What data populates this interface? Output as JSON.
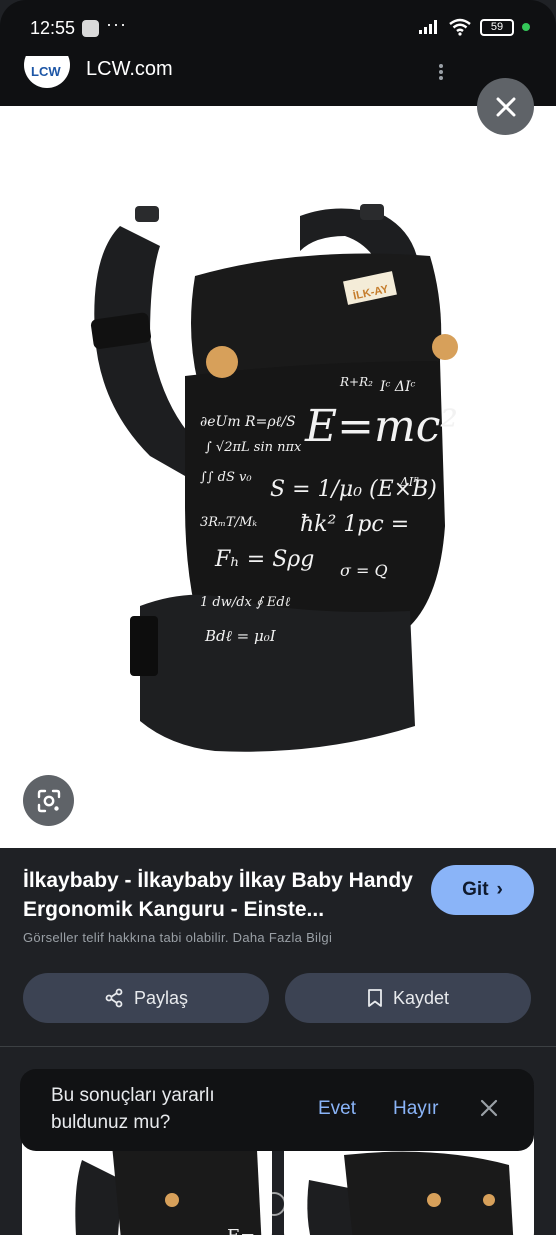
{
  "status_bar": {
    "time": "12:55",
    "app_icon": "notification-app-icon",
    "dots": "···",
    "battery": "59",
    "icons": [
      "signal-icon",
      "wifi-icon",
      "battery-icon"
    ]
  },
  "site": {
    "logo_text": "LCW",
    "name": "LCW.com"
  },
  "product_image": {
    "label_text": "İLK-AY",
    "formula": "E=mc²"
  },
  "result": {
    "title": "İlkaybaby - İlkaybaby İlkay Baby Handy Ergonomik Kanguru - Einste...",
    "git_label": "Git",
    "copyright": "Görseller telif hakkına tabi olabilir. Daha Fazla Bilgi",
    "share_label": "Paylaş",
    "save_label": "Kaydet"
  },
  "toast": {
    "question": "Bu sonuçları yararlı buldunuz mu?",
    "yes_label": "Evet",
    "no_label": "Hayır"
  },
  "colors": {
    "accent": "#8ab4f8",
    "background": "#1f2125",
    "button": "#3c4353"
  }
}
